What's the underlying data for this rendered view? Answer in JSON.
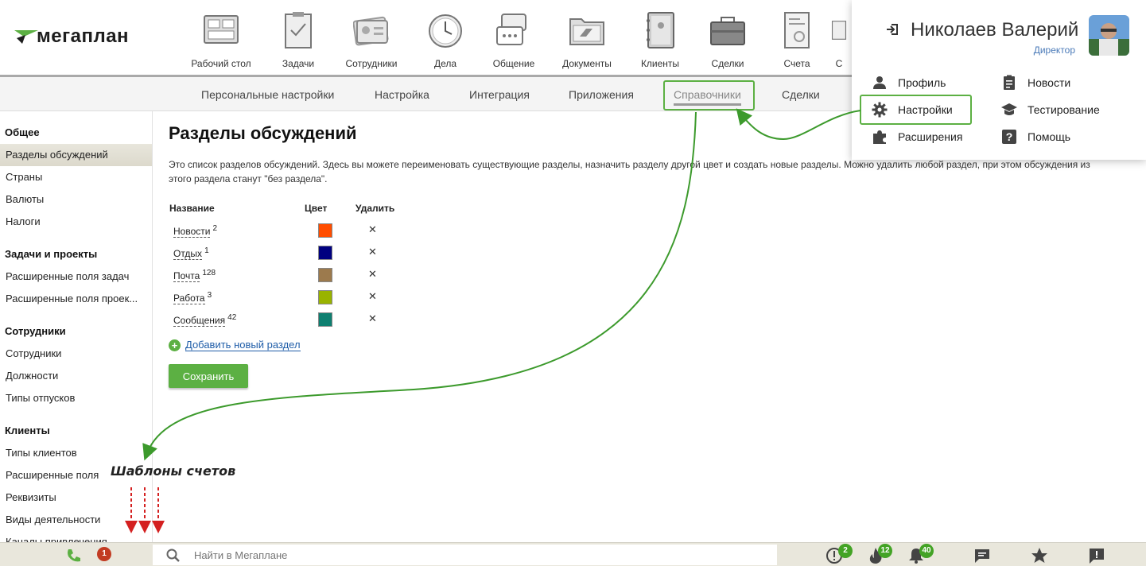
{
  "logo": {
    "text": "мегаплан"
  },
  "nav": [
    {
      "icon": "desktop-icon",
      "label": "Рабочий стол"
    },
    {
      "icon": "tasks-icon",
      "label": "Задачи"
    },
    {
      "icon": "employees-icon",
      "label": "Сотрудники"
    },
    {
      "icon": "clock-icon",
      "label": "Дела"
    },
    {
      "icon": "chat-icon",
      "label": "Общение"
    },
    {
      "icon": "folder-icon",
      "label": "Документы"
    },
    {
      "icon": "notebook-icon",
      "label": "Клиенты"
    },
    {
      "icon": "briefcase-icon",
      "label": "Сделки"
    },
    {
      "icon": "invoice-icon",
      "label": "Счета"
    },
    {
      "icon": "more-icon",
      "label": "С"
    }
  ],
  "subnav": {
    "tabs": [
      {
        "label": "Персональные настройки"
      },
      {
        "label": "Настройка"
      },
      {
        "label": "Интеграция"
      },
      {
        "label": "Приложения"
      },
      {
        "label": "Справочники",
        "active": true
      },
      {
        "label": "Сделки"
      }
    ]
  },
  "sidebar": {
    "groups": [
      {
        "title": "Общее",
        "items": [
          "Разделы обсуждений",
          "Страны",
          "Валюты",
          "Налоги"
        ]
      },
      {
        "title": "Задачи и проекты",
        "items": [
          "Расширенные поля задач",
          "Расширенные поля проек..."
        ]
      },
      {
        "title": "Сотрудники",
        "items": [
          "Сотрудники",
          "Должности",
          "Типы отпусков"
        ]
      },
      {
        "title": "Клиенты",
        "items": [
          "Типы клиентов",
          "Расширенные поля",
          "Реквизиты",
          "Виды деятельности",
          "Каналы привлечения"
        ]
      }
    ],
    "active_item": "Разделы обсуждений"
  },
  "main": {
    "title": "Разделы обсуждений",
    "description": "Это список разделов обсуждений. Здесь вы можете переименовать существующие разделы, назначить разделу другой цвет и создать новые разделы. Можно удалить любой раздел, при этом обсуждения из этого раздела станут \"без раздела\".",
    "columns": {
      "name": "Название",
      "color": "Цвет",
      "delete": "Удалить"
    },
    "sections": [
      {
        "name": "Новости",
        "count": "2",
        "color": "#ff4d00"
      },
      {
        "name": "Отдых",
        "count": "1",
        "color": "#000080"
      },
      {
        "name": "Почта",
        "count": "128",
        "color": "#9c7a4d"
      },
      {
        "name": "Работа",
        "count": "3",
        "color": "#99b300"
      },
      {
        "name": "Сообщения",
        "count": "42",
        "color": "#0e7f70"
      }
    ],
    "delete_symbol": "✕",
    "add_label": "Добавить новый раздел",
    "save_label": "Сохранить"
  },
  "user_menu": {
    "name": "Николаев Валерий",
    "role": "Директор",
    "items_left": [
      {
        "icon": "person-icon",
        "label": "Профиль"
      },
      {
        "icon": "gear-icon",
        "label": "Настройки"
      },
      {
        "icon": "puzzle-icon",
        "label": "Расширения"
      }
    ],
    "items_right": [
      {
        "icon": "clipboard-icon",
        "label": "Новости"
      },
      {
        "icon": "graduation-cap-icon",
        "label": "Тестирование"
      },
      {
        "icon": "help-icon",
        "label": "Помощь"
      }
    ]
  },
  "footer": {
    "phone_badge": "1",
    "search_placeholder": "Найти в Мегаплане",
    "badges": {
      "alerts": "2",
      "hot": "12",
      "notifications": "40"
    }
  },
  "annotation": {
    "text": "Шаблоны счетов"
  },
  "colors": {
    "accent_green": "#5cb043",
    "link_blue": "#1f5da8",
    "badge_red": "#c23b22"
  }
}
